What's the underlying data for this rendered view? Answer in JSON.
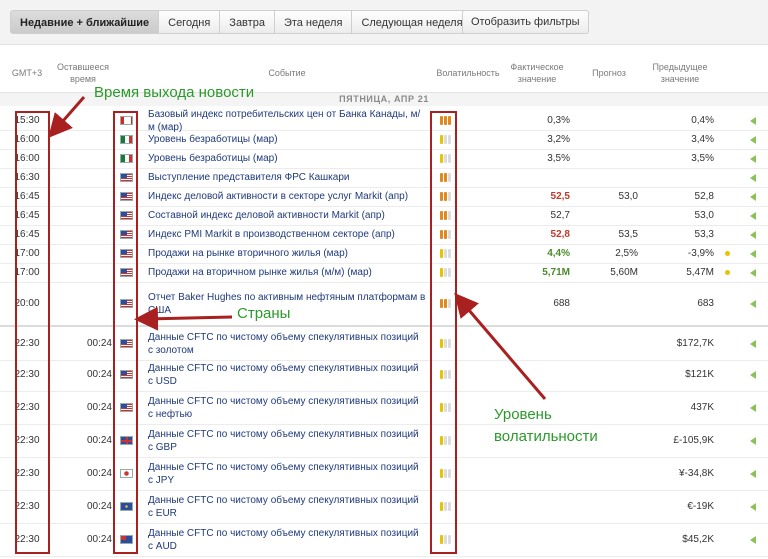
{
  "toolbar": {
    "tabs": [
      {
        "label": "Недавние + ближайшие",
        "active": true
      },
      {
        "label": "Сегодня",
        "active": false
      },
      {
        "label": "Завтра",
        "active": false
      },
      {
        "label": "Эта неделя",
        "active": false
      },
      {
        "label": "Следующая неделя",
        "active": false
      }
    ],
    "calendar_icon": "calendar-icon",
    "filter_label": "Отобразить фильтры"
  },
  "columns": {
    "tz": "GMT+3",
    "remaining": "Оставшееся время",
    "event": "Событие",
    "volatility": "Волатильность",
    "actual": "Фактическое значение",
    "forecast": "Прогноз",
    "previous": "Предыдущее значение"
  },
  "date_header": "ПЯТНИЦА, АПР 21",
  "colors": {
    "bull_orange": "#e08a1e",
    "bull_yellow": "#e8c400",
    "bull_gray": "#dcdcdc",
    "actual_red": "#c0392b",
    "actual_green": "#4a8a2a",
    "annotation_green": "#2a9a2a",
    "annotation_red": "#a82020"
  },
  "rows": [
    {
      "time": "15:30",
      "left": "",
      "flag": "ca",
      "event": "Базовый индекс потребительских цен от Банка Канады, м/м (мар)",
      "vol": 3,
      "actual": "0,3%",
      "actual_color": "",
      "forecast": "",
      "previous": "0,4%",
      "dot": false
    },
    {
      "time": "16:00",
      "left": "",
      "flag": "mx",
      "event": "Уровень безработицы (мар)",
      "vol": 1,
      "actual": "3,2%",
      "actual_color": "",
      "forecast": "",
      "previous": "3,4%",
      "dot": false
    },
    {
      "time": "16:00",
      "left": "",
      "flag": "mx",
      "event": "Уровень безработицы (мар)",
      "vol": 1,
      "actual": "3,5%",
      "actual_color": "",
      "forecast": "",
      "previous": "3,5%",
      "dot": false
    },
    {
      "time": "16:30",
      "left": "",
      "flag": "us",
      "event": "Выступление представителя ФРС Кашкари",
      "vol": 2,
      "actual": "",
      "actual_color": "",
      "forecast": "",
      "previous": "",
      "dot": false
    },
    {
      "time": "16:45",
      "left": "",
      "flag": "us",
      "event": "Индекс деловой активности в секторе услуг Markit (апр)",
      "vol": 2,
      "actual": "52,5",
      "actual_color": "red",
      "forecast": "53,0",
      "previous": "52,8",
      "dot": false
    },
    {
      "time": "16:45",
      "left": "",
      "flag": "us",
      "event": "Составной индекс деловой активности Markit (апр)",
      "vol": 2,
      "actual": "52,7",
      "actual_color": "",
      "forecast": "",
      "previous": "53,0",
      "dot": false
    },
    {
      "time": "16:45",
      "left": "",
      "flag": "us",
      "event": "Индекс PMI Markit в производственном секторе (апр)",
      "vol": 2,
      "actual": "52,8",
      "actual_color": "red",
      "forecast": "53,5",
      "previous": "53,3",
      "dot": false
    },
    {
      "time": "17:00",
      "left": "",
      "flag": "us",
      "event": "Продажи на рынке вторичного жилья (мар)",
      "vol": 1,
      "actual": "4,4%",
      "actual_color": "green",
      "forecast": "2,5%",
      "previous": "-3,9%",
      "dot": true
    },
    {
      "time": "17:00",
      "left": "",
      "flag": "us",
      "event": "Продажи на вторичном рынке жилья (м/м) (мар)",
      "vol": 1,
      "actual": "5,71M",
      "actual_color": "green",
      "forecast": "5,60M",
      "previous": "5,47M",
      "dot": true
    },
    {
      "time": "20:00",
      "left": "",
      "flag": "us",
      "event": "Отчет Baker Hughes по активным нефтяным платформам в США",
      "vol": 2,
      "actual": "688",
      "actual_color": "",
      "forecast": "",
      "previous": "683",
      "dot": false
    },
    {
      "time": "22:30",
      "left": "00:24",
      "flag": "us",
      "event": "Данные CFTC по чистому объему спекулятивных позиций с золотом",
      "vol": 1,
      "actual": "",
      "actual_color": "",
      "forecast": "",
      "previous": "$172,7K",
      "dot": false
    },
    {
      "time": "22:30",
      "left": "00:24",
      "flag": "us",
      "event": "Данные CFTC по чистому объему спекулятивных позиций с USD",
      "vol": 1,
      "actual": "",
      "actual_color": "",
      "forecast": "",
      "previous": "$121K",
      "dot": false
    },
    {
      "time": "22:30",
      "left": "00:24",
      "flag": "us",
      "event": "Данные CFTC по чистому объему спекулятивных позиций с нефтью",
      "vol": 1,
      "actual": "",
      "actual_color": "",
      "forecast": "",
      "previous": "437K",
      "dot": false
    },
    {
      "time": "22:30",
      "left": "00:24",
      "flag": "gb",
      "event": "Данные CFTC по чистому объему спекулятивных позиций с GBP",
      "vol": 1,
      "actual": "",
      "actual_color": "",
      "forecast": "",
      "previous": "£-105,9K",
      "dot": false
    },
    {
      "time": "22:30",
      "left": "00:24",
      "flag": "jp",
      "event": "Данные CFTC по чистому объему спекулятивных позиций с JPY",
      "vol": 1,
      "actual": "",
      "actual_color": "",
      "forecast": "",
      "previous": "¥-34,8K",
      "dot": false
    },
    {
      "time": "22:30",
      "left": "00:24",
      "flag": "eu",
      "event": "Данные CFTC по чистому объему спекулятивных позиций с EUR",
      "vol": 1,
      "actual": "",
      "actual_color": "",
      "forecast": "",
      "previous": "€-19K",
      "dot": false
    },
    {
      "time": "22:30",
      "left": "00:24",
      "flag": "au",
      "event": "Данные CFTC по чистому объему спекулятивных позиций с AUD",
      "vol": 1,
      "actual": "",
      "actual_color": "",
      "forecast": "",
      "previous": "$45,2K",
      "dot": false
    }
  ],
  "annotations": {
    "release_time": "Время выхода новости",
    "countries": "Страны",
    "volatility": "Уровень волатильности"
  }
}
